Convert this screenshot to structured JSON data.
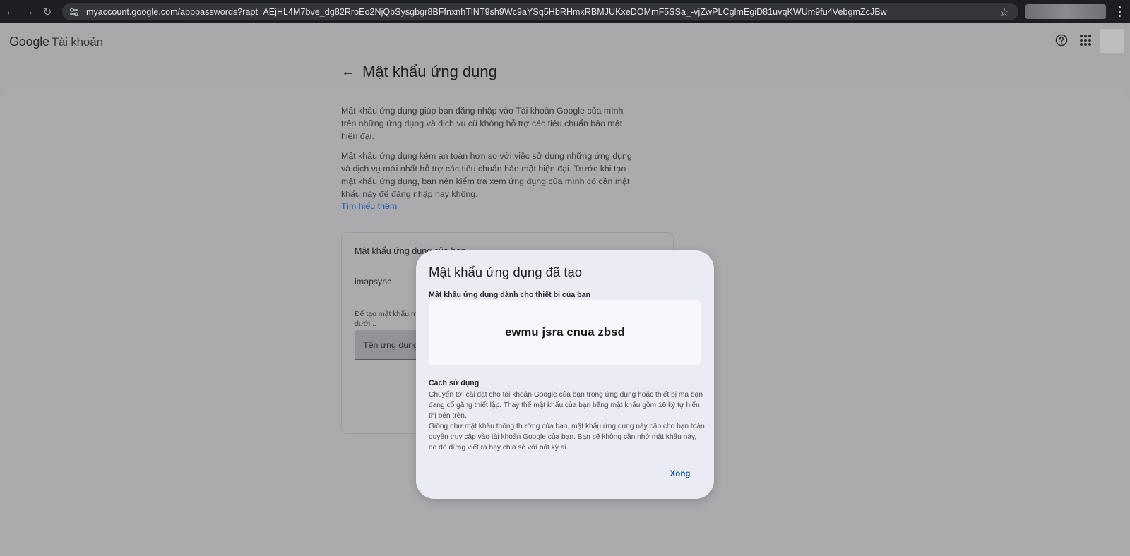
{
  "browser": {
    "url": "myaccount.google.com/apppasswords?rapt=AEjHL4M7bve_dg82RroEo2NjQbSysgbgr8BFfnxnhTlNT9sh9Wc9aYSq5HbRHmxRBMJUKxeDOMmF5SSa_-vjZwPLCglmEgiD81uvqKWUm9fu4VebgmZcJBw"
  },
  "header": {
    "brand": "Google",
    "brand_sub": "Tài khoản"
  },
  "page": {
    "title": "Mật khẩu ứng dụng",
    "intro": "Mật khẩu ứng dụng giúp bạn đăng nhập vào Tài khoản Google của mình trên những ứng dụng và dịch vụ cũ không hỗ trợ các tiêu chuẩn bảo mật hiện đại.",
    "warning": "Mật khẩu ứng dụng kém an toàn hơn so với việc sử dụng những ứng dụng và dịch vụ mới nhất hỗ trợ các tiêu chuẩn bảo mật hiện đại. Trước khi tạo mật khẩu ứng dụng, bạn nên kiểm tra xem ứng dụng của mình có cần mật khẩu này để đăng nhập hay không.",
    "learn_more": "Tìm hiểu thêm"
  },
  "card": {
    "title": "Mật khẩu ứng dụng của bạn",
    "item": "imapsync",
    "note": "Để tạo mật khẩu m dưới...",
    "input_label": "Tên ứng dụng"
  },
  "dialog": {
    "title": "Mật khẩu ứng dụng đã tạo",
    "password_label": "Mật khẩu ứng dụng dành cho thiết bị của bạn",
    "password": "ewmu jsra cnua zbsd",
    "usage_title": "Cách sử dụng",
    "usage_text_1": "Chuyển tới cài đặt cho tài khoản Google của bạn trong ứng dụng hoặc thiết bị mà bạn đang cố gắng thiết lập. Thay thế mật khẩu của bạn bằng mật khẩu gồm 16 ký tự hiển thị bên trên.",
    "usage_text_2": "Giống như mật khẩu thông thường của bạn, mật khẩu ứng dụng này cấp cho bạn toàn quyền truy cập vào tài khoản Google của bạn. Bạn sẽ không cần nhớ mật khẩu này, do đó đừng viết ra hay chia sẻ với bất kỳ ai.",
    "done_label": "Xong"
  }
}
